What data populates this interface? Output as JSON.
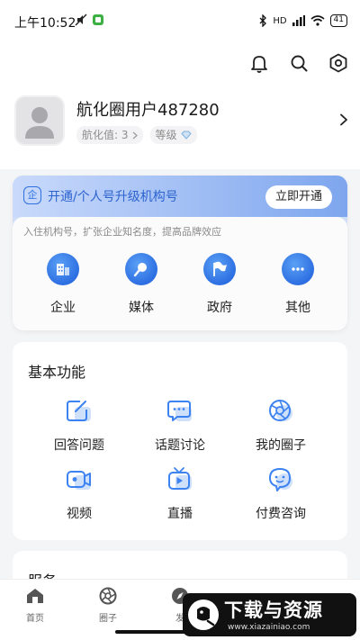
{
  "status_bar": {
    "time": "上午10:52",
    "network_label": "HD",
    "battery": "41"
  },
  "header": {
    "icons": [
      "bell-icon",
      "search-icon",
      "settings-hexagon-icon"
    ]
  },
  "profile": {
    "username": "航化圈用户487280",
    "score_label": "航化值: 3",
    "level_label": "等级"
  },
  "upgrade": {
    "badge": "企",
    "title": "开通/个人号升级机构号",
    "button": "立即开通",
    "description": "入住机构号，扩张企业知名度，提高品牌效应",
    "items": [
      {
        "label": "企业",
        "icon": "building-icon"
      },
      {
        "label": "媒体",
        "icon": "microphone-icon"
      },
      {
        "label": "政府",
        "icon": "flag-icon"
      },
      {
        "label": "其他",
        "icon": "more-icon"
      }
    ]
  },
  "features": {
    "title": "基本功能",
    "items": [
      {
        "label": "回答问题",
        "icon": "edit-icon"
      },
      {
        "label": "话题讨论",
        "icon": "chat-icon"
      },
      {
        "label": "我的圈子",
        "icon": "aperture-icon"
      },
      {
        "label": "视频",
        "icon": "video-camera-icon"
      },
      {
        "label": "直播",
        "icon": "tv-play-icon"
      },
      {
        "label": "付费咨询",
        "icon": "consult-icon"
      }
    ]
  },
  "services": {
    "title": "服务"
  },
  "tabbar": {
    "items": [
      {
        "label": "首页",
        "icon": "home-icon"
      },
      {
        "label": "圈子",
        "icon": "aperture-icon"
      },
      {
        "label": "发",
        "icon": "compass-icon"
      }
    ]
  },
  "watermark": {
    "title": "下载与资源",
    "url": "www.xiazainiao.com"
  },
  "colors": {
    "accent": "#2f6fe0",
    "icon_blue": "#3c82f0",
    "icon_light": "#cfe0fb"
  }
}
